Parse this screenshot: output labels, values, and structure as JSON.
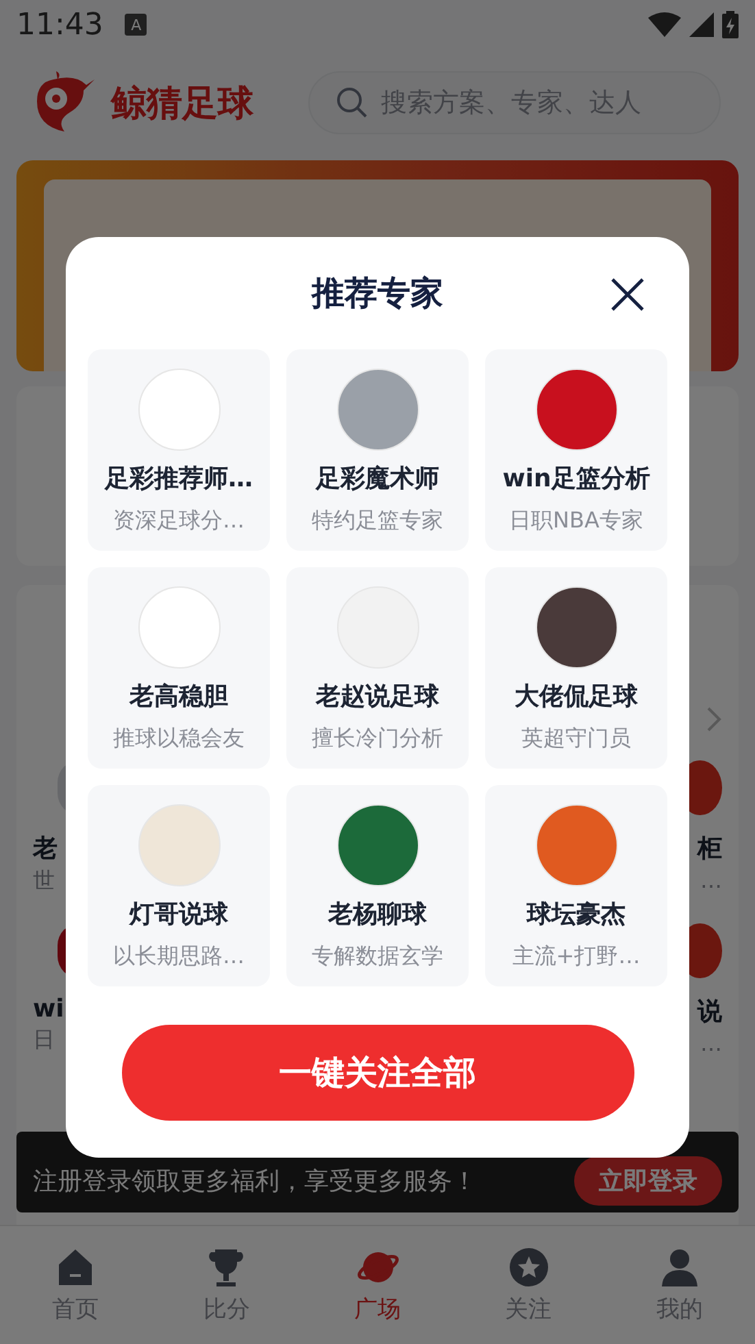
{
  "status_bar": {
    "time": "11:43",
    "notification": "A"
  },
  "header": {
    "logo_text": "鲸猜足球",
    "search": {
      "placeholder": "搜索方案、专家、达人"
    }
  },
  "hot_section": {
    "rows": [
      {
        "left_name": "老",
        "left_sub": "世",
        "right_name": "柜",
        "right_sub": "…"
      },
      {
        "left_name": "wi",
        "left_sub": "日",
        "right_name": "说",
        "right_sub": "…"
      }
    ]
  },
  "login_bar": {
    "text": "注册登录领取更多福利，享受更多服务！",
    "button": "立即登录"
  },
  "tabs": [
    {
      "label": "首页",
      "selected": false
    },
    {
      "label": "比分",
      "selected": false
    },
    {
      "label": "广场",
      "selected": true
    },
    {
      "label": "关注",
      "selected": false
    },
    {
      "label": "我的",
      "selected": false
    }
  ],
  "dialog": {
    "title": "推荐专家",
    "experts": [
      {
        "name": "足彩推荐师…",
        "desc": "资深足球分…"
      },
      {
        "name": "足彩魔术师",
        "desc": "特约足篮专家"
      },
      {
        "name": "win足篮分析",
        "desc": "日职NBA专家"
      },
      {
        "name": "老高稳胆",
        "desc": "推球以稳会友"
      },
      {
        "name": "老赵说足球",
        "desc": "擅长冷门分析"
      },
      {
        "name": "大佬侃足球",
        "desc": "英超守门员"
      },
      {
        "name": "灯哥说球",
        "desc": "以长期思路…"
      },
      {
        "name": "老杨聊球",
        "desc": "专解数据玄学"
      },
      {
        "name": "球坛豪杰",
        "desc": "主流+打野…"
      }
    ],
    "button": "一键关注全部"
  }
}
